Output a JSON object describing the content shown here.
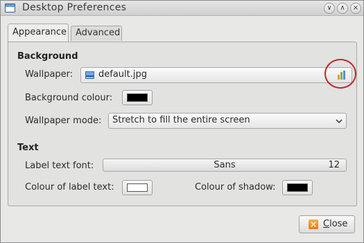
{
  "window": {
    "title": "Desktop Preferences",
    "controls": {
      "minimize": "∨",
      "maximize": "∧",
      "close": "×"
    }
  },
  "tabs": [
    {
      "label": "Appearance",
      "active": true
    },
    {
      "label": "Advanced",
      "active": false
    }
  ],
  "background": {
    "heading": "Background",
    "wallpaper_label": "Wallpaper:",
    "wallpaper_file": "default.jpg",
    "background_colour_label": "Background colour:",
    "background_colour": "#000000",
    "wallpaper_mode_label": "Wallpaper mode:",
    "wallpaper_mode": "Stretch to fill the entire screen"
  },
  "text": {
    "heading": "Text",
    "label_font_label": "Label text font:",
    "font_name": "Sans",
    "font_size": "12",
    "label_colour_label": "Colour of label text:",
    "label_colour": "#ffffff",
    "shadow_colour_label": "Colour of shadow:",
    "shadow_colour": "#000000"
  },
  "footer": {
    "close_first": "C",
    "close_rest": "lose"
  },
  "icons": {
    "app": "window-icon",
    "wallpaper_file": "image-file-icon",
    "browse": "folder-browse-icon",
    "close": "close-icon"
  },
  "colors": {
    "highlight": "#c0292f"
  }
}
